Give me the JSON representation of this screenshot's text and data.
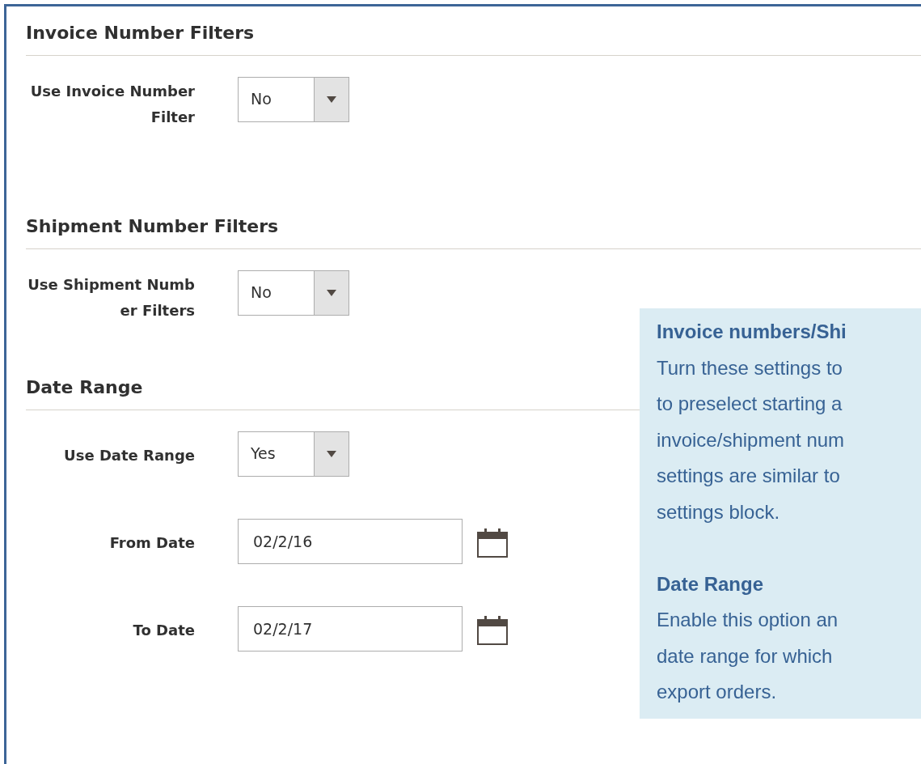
{
  "sections": [
    {
      "title": "Invoice Number Filters",
      "fields": [
        {
          "kind": "select",
          "label": "Use Invoice NumberFilter",
          "value": "No"
        }
      ]
    },
    {
      "title": "Shipment Number Filters",
      "fields": [
        {
          "kind": "select",
          "label": "Use Shipment Number Filters",
          "value": "No"
        }
      ]
    },
    {
      "title": "Date Range",
      "fields": [
        {
          "kind": "select",
          "label": "Use Date Range",
          "value": "Yes"
        },
        {
          "kind": "date",
          "label": "From Date",
          "value": "02/2/16"
        },
        {
          "kind": "date",
          "label": "To Date",
          "value": "02/2/17"
        }
      ]
    }
  ],
  "callout": {
    "blocks": [
      {
        "title": "Invoice numbers/Shi",
        "lines": [
          "Turn these settings to",
          "to preselect starting a",
          "invoice/shipment num",
          "settings are similar to",
          "settings block."
        ]
      },
      {
        "title": "Date Range",
        "lines": [
          "Enable this option an",
          "date range for which",
          "export orders."
        ]
      }
    ]
  }
}
